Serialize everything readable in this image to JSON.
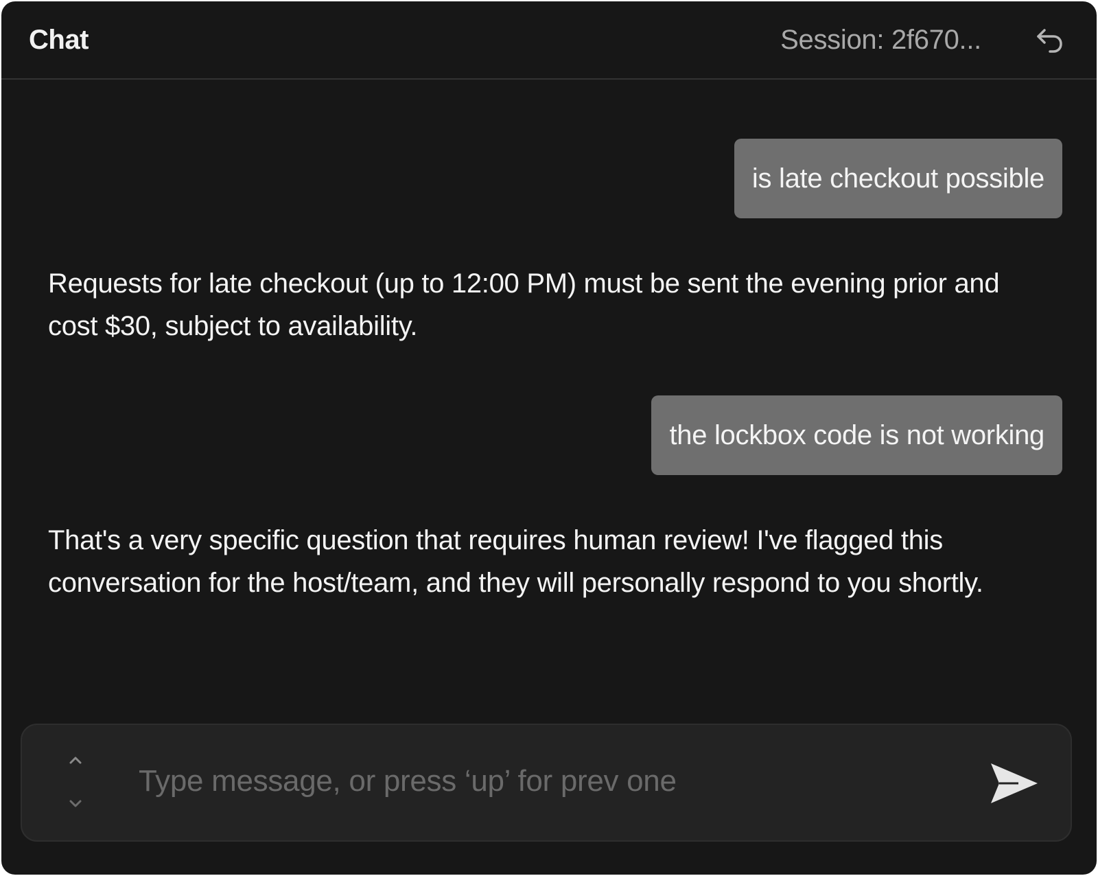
{
  "header": {
    "title": "Chat",
    "session_label": "Session: 2f670...",
    "undo_icon": "undo-arrow-icon"
  },
  "messages": [
    {
      "role": "user",
      "text": "is late checkout possible"
    },
    {
      "role": "assistant",
      "text": "Requests for late checkout (up to 12:00 PM) must be sent the evening prior and cost $30, subject to availability."
    },
    {
      "role": "user",
      "text": "the lockbox code is not working"
    },
    {
      "role": "assistant",
      "text": "That's a very specific question that requires human review! I've flagged this conversation for the host/team, and they will personally respond to you shortly."
    }
  ],
  "composer": {
    "placeholder": "Type message, or press ‘up’ for prev one",
    "value": "",
    "history_up_icon": "chevron-up-icon",
    "history_down_icon": "chevron-down-icon",
    "send_icon": "send-icon"
  },
  "colors": {
    "background": "#171717",
    "user_bubble": "#6f6f6f",
    "composer_bg": "#232323",
    "text": "#f4f4f4",
    "muted_text": "#a9a9a9"
  }
}
